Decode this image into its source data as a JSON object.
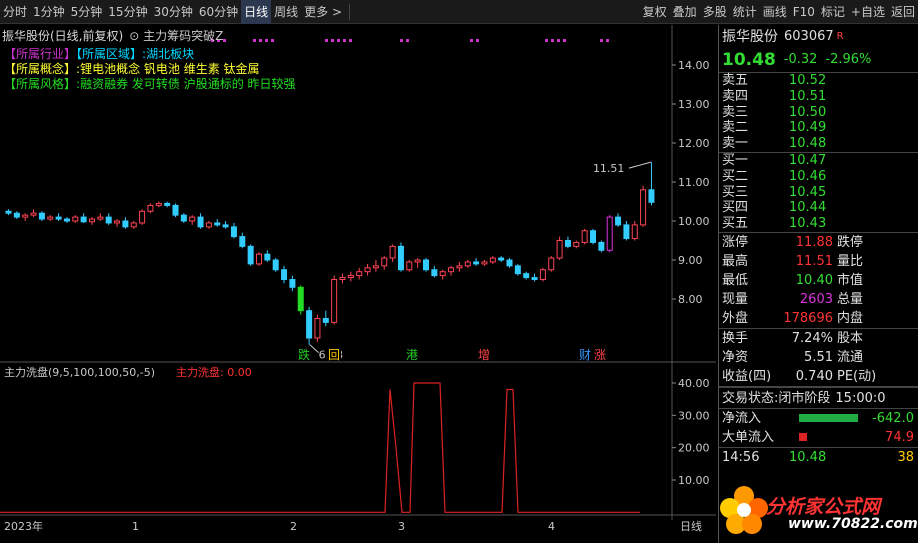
{
  "toolbar": {
    "items": [
      "分时",
      "1分钟",
      "5分钟",
      "15分钟",
      "30分钟",
      "60分钟",
      "日线",
      "周线",
      "更多 >"
    ],
    "active_index": 6,
    "right_items": [
      "复权",
      "叠加",
      "多股",
      "统计",
      "画线",
      "F10",
      "标记",
      "+自选",
      "返回"
    ]
  },
  "chart": {
    "title": "振华股份(日线,前复权)",
    "indicator": "主力筹码突破Z",
    "tags": [
      {
        "key": "【所属行业】",
        "key2": "【所属区域】",
        "sep": ":",
        "value": "湖北板块"
      },
      {
        "key": "【所属概念】",
        "sep": ":",
        "value": "锂电池概念 钒电池 维生素 钛金属"
      },
      {
        "key": "【所属风格】",
        "sep": ":",
        "value": "融资融券 发可转债 沪股通标的 昨日较强"
      }
    ],
    "price_axis": [
      "14.00",
      "13.00",
      "12.00",
      "11.00",
      "10.00",
      "9.00",
      "8.00"
    ],
    "high_label": "11.51",
    "low_label": "6.83",
    "events": [
      {
        "text": "跌",
        "color": "#22cc22"
      },
      {
        "text": "回",
        "color": "#ffcc00"
      },
      {
        "text": "港",
        "color": "#22cc22"
      },
      {
        "text": "增",
        "color": "#ff4444"
      },
      {
        "text": "财",
        "color": "#3399ff"
      },
      {
        "text": "涨",
        "color": "#ff4444"
      }
    ],
    "sub_title": "主力洗盘(9,5,100,100,50,-5)",
    "sub_value_label": "主力洗盘: 0.00",
    "sub_axis": [
      "40.00",
      "30.00",
      "20.00",
      "10.00"
    ],
    "date_axis": [
      "2023年",
      "1",
      "2",
      "3",
      "4"
    ],
    "period_label": "日线"
  },
  "stock": {
    "name": "振华股份",
    "code": "603067",
    "badge": "R",
    "price": "10.48",
    "change": "-0.32",
    "change_pct": "-2.96%"
  },
  "orderbook": {
    "asks": [
      {
        "label": "卖五",
        "price": "10.52"
      },
      {
        "label": "卖四",
        "price": "10.51"
      },
      {
        "label": "卖三",
        "price": "10.50"
      },
      {
        "label": "卖二",
        "price": "10.49"
      },
      {
        "label": "卖一",
        "price": "10.48"
      }
    ],
    "bids": [
      {
        "label": "买一",
        "price": "10.47"
      },
      {
        "label": "买二",
        "price": "10.46"
      },
      {
        "label": "买三",
        "price": "10.45"
      },
      {
        "label": "买四",
        "price": "10.44"
      },
      {
        "label": "买五",
        "price": "10.43"
      }
    ]
  },
  "stats1": [
    {
      "label": "涨停",
      "value": "11.88",
      "color": "red",
      "label2": "跌停"
    },
    {
      "label": "最高",
      "value": "11.51",
      "color": "red",
      "label2": "量比"
    },
    {
      "label": "最低",
      "value": "10.40",
      "color": "green",
      "label2": "市值"
    },
    {
      "label": "现量",
      "value": "2603",
      "color": "magenta",
      "label2": "总量"
    },
    {
      "label": "外盘",
      "value": "178696",
      "color": "red",
      "label2": "内盘"
    }
  ],
  "stats2": [
    {
      "label": "换手",
      "value": "7.24%",
      "label2": "股本"
    },
    {
      "label": "净资",
      "value": "5.51",
      "label2": "流通"
    },
    {
      "label": "收益(四)",
      "value": "0.740",
      "label2": "PE(动)"
    }
  ],
  "status": {
    "label": "交易状态:",
    "value": "闭市阶段",
    "time": "15:00:0"
  },
  "flows": [
    {
      "label": "净流入",
      "value": "-642.0",
      "bar_color": "#22aa44",
      "value_color": "green",
      "bar_fraction": 0.9
    },
    {
      "label": "大单流入",
      "value": "74.9",
      "bar_color": "#dd2222",
      "value_color": "red",
      "bar_fraction": 0.12
    }
  ],
  "tick": {
    "time": "14:56",
    "price": "10.48",
    "vol": "38"
  },
  "watermark": {
    "text": "分析家公式网",
    "url": "www.70822.com"
  }
}
